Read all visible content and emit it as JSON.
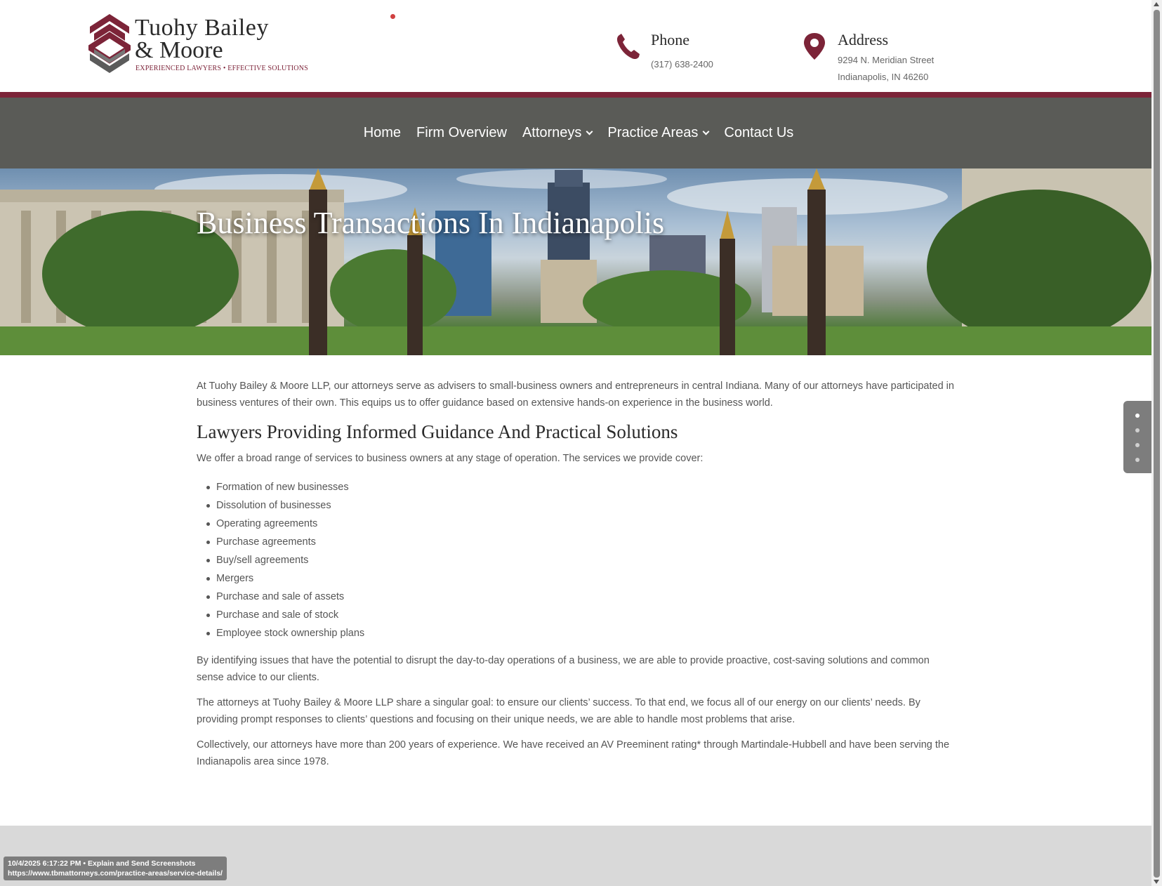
{
  "header": {
    "logo": {
      "name_line1": "Tuohy Bailey",
      "name_line2": "& Moore",
      "tagline": "EXPERIENCED LAWYERS  •  EFFECTIVE SOLUTIONS"
    },
    "phone": {
      "title": "Phone",
      "number": "(317) 638-2400"
    },
    "address": {
      "title": "Address",
      "line1": "9294 N. Meridian Street",
      "line2": "Indianapolis, IN 46260"
    }
  },
  "nav": {
    "items": [
      {
        "label": "Home",
        "has_dropdown": false
      },
      {
        "label": "Firm Overview",
        "has_dropdown": false
      },
      {
        "label": "Attorneys",
        "has_dropdown": true
      },
      {
        "label": "Practice Areas",
        "has_dropdown": true
      },
      {
        "label": "Contact Us",
        "has_dropdown": false
      }
    ]
  },
  "hero": {
    "title": "Business Transactions In Indianapolis"
  },
  "content": {
    "intro": "At Tuohy Bailey & Moore LLP, our attorneys serve as advisers to small-business owners and entrepreneurs in central Indiana. Many of our attorneys have participated in business ventures of their own. This equips us to offer guidance based on extensive hands-on experience in the business world.",
    "heading": "Lawyers Providing Informed Guidance And Practical Solutions",
    "services_intro": "We offer a broad range of services to business owners at any stage of operation. The services we provide cover:",
    "services": [
      "Formation of new businesses",
      "Dissolution of businesses",
      "Operating agreements",
      "Purchase agreements",
      "Buy/sell agreements",
      "Mergers",
      "Purchase and sale of assets",
      "Purchase and sale of stock",
      "Employee stock ownership plans"
    ],
    "para2": "By identifying issues that have the potential to disrupt the day-to-day operations of a business, we are able to provide proactive, cost-saving solutions and common sense advice to our clients.",
    "para3": "The attorneys at Tuohy Bailey & Moore LLP share a singular goal: to ensure our clients’ success. To that end, we focus all of our energy on our clients’ needs. By providing prompt responses to clients’ questions and focusing on their unique needs, we are able to handle most problems that arise.",
    "para4": "Collectively, our attorneys have more than 200 years of experience. We have received an AV Preeminent rating* through Martindale-Hubbell and have been serving the Indianapolis area since 1978."
  },
  "screenshot_badge": {
    "line1": "10/4/2025 6:17:22 PM • Explain and Send Screenshots",
    "line2": "https://www.tbmattorneys.com/practice-areas/service-details/"
  },
  "side_dots": {
    "count": 4,
    "active_index": 0
  },
  "colors": {
    "accent": "#7c2438",
    "nav_bg": "#5a5b57",
    "footer_bg": "#d9d9d9"
  }
}
